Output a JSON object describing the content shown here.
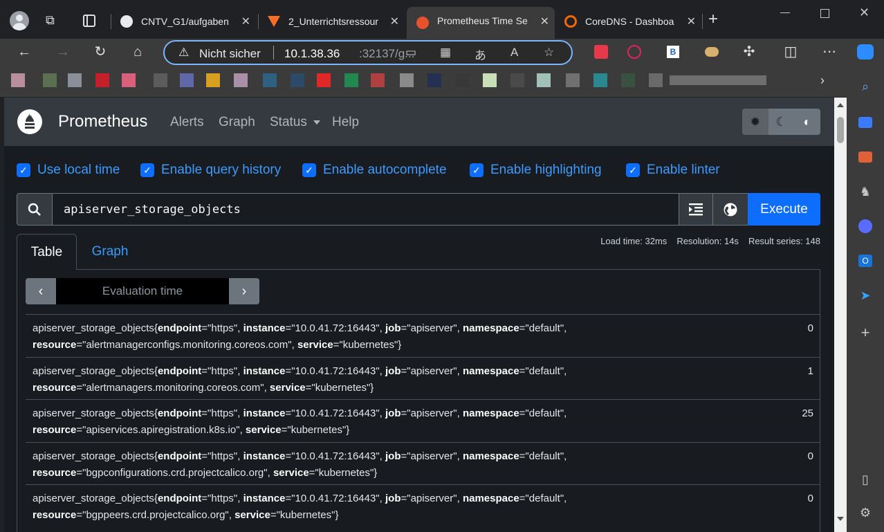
{
  "browser": {
    "tabs": [
      {
        "title": "CNTV_G1/aufgaben",
        "icon": "github-icon"
      },
      {
        "title": "2_Unterrichtsressour",
        "icon": "gitlab-icon"
      },
      {
        "title": "Prometheus Time Se",
        "icon": "prometheus-icon",
        "active": true
      },
      {
        "title": "CoreDNS - Dashboa",
        "icon": "grafana-icon"
      }
    ],
    "tab_close": "✕",
    "new_tab": "+",
    "address": {
      "security_label": "Nicht sicher",
      "url_host": "10.1.38.36",
      "url_rest": ":32137/g..."
    }
  },
  "navbar": {
    "brand": "Prometheus",
    "links": [
      "Alerts",
      "Graph",
      "Status",
      "Help"
    ]
  },
  "options": [
    "Use local time",
    "Enable query history",
    "Enable autocomplete",
    "Enable highlighting",
    "Enable linter"
  ],
  "query": {
    "expression": "apiserver_storage_objects",
    "execute_label": "Execute"
  },
  "stats": {
    "load_time": "Load time: 32ms",
    "resolution": "Resolution: 14s",
    "result_series": "Result series: 148"
  },
  "result_tabs": {
    "table": "Table",
    "graph": "Graph"
  },
  "eval_time": {
    "placeholder": "Evaluation time"
  },
  "results": [
    {
      "metric": "apiserver_storage_objects",
      "endpoint": "https",
      "instance": "10.0.41.72:16443",
      "job": "apiserver",
      "namespace": "default",
      "resource": "alertmanagerconfigs.monitoring.coreos.com",
      "service": "kubernetes",
      "value": "0"
    },
    {
      "metric": "apiserver_storage_objects",
      "endpoint": "https",
      "instance": "10.0.41.72:16443",
      "job": "apiserver",
      "namespace": "default",
      "resource": "alertmanagers.monitoring.coreos.com",
      "service": "kubernetes",
      "value": "1"
    },
    {
      "metric": "apiserver_storage_objects",
      "endpoint": "https",
      "instance": "10.0.41.72:16443",
      "job": "apiserver",
      "namespace": "default",
      "resource": "apiservices.apiregistration.k8s.io",
      "service": "kubernetes",
      "value": "25"
    },
    {
      "metric": "apiserver_storage_objects",
      "endpoint": "https",
      "instance": "10.0.41.72:16443",
      "job": "apiserver",
      "namespace": "default",
      "resource": "bgpconfigurations.crd.projectcalico.org",
      "service": "kubernetes",
      "value": "0"
    },
    {
      "metric": "apiserver_storage_objects",
      "endpoint": "https",
      "instance": "10.0.41.72:16443",
      "job": "apiserver",
      "namespace": "default",
      "resource": "bgppeers.crd.projectcalico.org",
      "service": "kubernetes",
      "value": "0"
    }
  ],
  "colors": {
    "accent": "#0d6efd",
    "link": "#3b9bff",
    "navbar": "#343a40",
    "page_bg": "#181b1f"
  }
}
